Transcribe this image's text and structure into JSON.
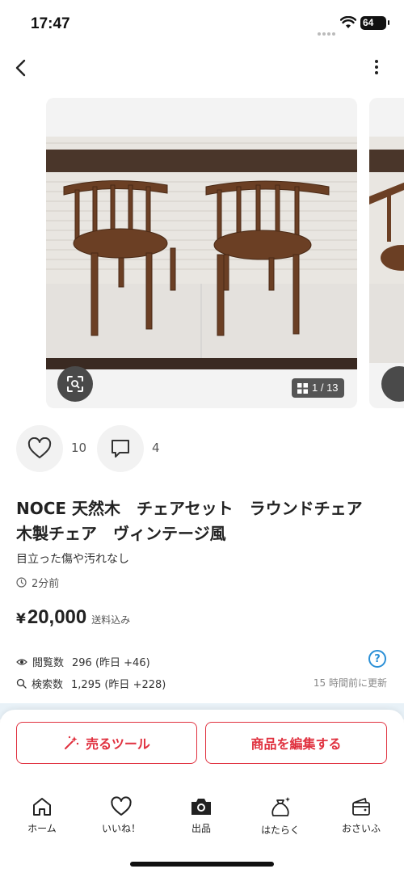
{
  "status_bar": {
    "time": "17:47",
    "battery": "64"
  },
  "gallery": {
    "counter": "1 / 13"
  },
  "reactions": {
    "likes": "10",
    "comments": "4"
  },
  "product": {
    "title": "NOCE 天然木　チェアセット　ラウンドチェア　木製チェア　ヴィンテージ風",
    "condition": "目立った傷や汚れなし",
    "posted": "2分前",
    "price_symbol": "¥",
    "price": "20,000",
    "shipping": "送料込み"
  },
  "stats": {
    "views_label": "閲覧数",
    "views_value": "296 (昨日 +46)",
    "searches_label": "検索数",
    "searches_value": "1,295 (昨日 +228)",
    "updated": "15 時間前に更新"
  },
  "actions": {
    "sell_tool": "売るツール",
    "edit": "商品を編集する"
  },
  "tabs": [
    {
      "label": "ホーム",
      "icon": "home-icon"
    },
    {
      "label": "いいね！",
      "icon": "heart-icon"
    },
    {
      "label": "出品",
      "icon": "camera-icon"
    },
    {
      "label": "はたらく",
      "icon": "money-bag-icon"
    },
    {
      "label": "おさいふ",
      "icon": "wallet-icon"
    }
  ],
  "colors": {
    "accent": "#e0313f",
    "info": "#2a8fd6"
  }
}
